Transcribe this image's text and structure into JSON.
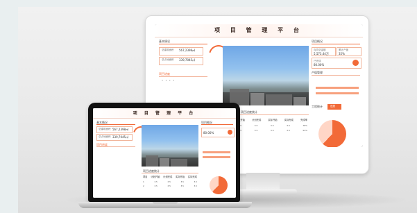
{
  "scene": {
    "background_color": "#e9eff0",
    "accent_color": "#f26a38"
  },
  "monitor": {
    "dashboard": {
      "title": "项 目 管 理 平 台",
      "left": {
        "panel_title": "基本情况",
        "metrics": [
          {
            "label": "总建筑面积",
            "value": "567,2398㎡"
          },
          {
            "label": "总占地面积",
            "value": "339,7045㎡"
          }
        ],
        "section_title": "项目进度"
      },
      "right": {
        "panel_title": "项目概况",
        "cards": [
          {
            "label": "合同总金额",
            "value": "5,573.44万"
          },
          {
            "label": "累计产值",
            "value": "35%"
          },
          {
            "label": "已完成",
            "value": "80.00%"
          }
        ],
        "section_title": "产值管理",
        "lower_title": "工程统计",
        "tab_active": "进度"
      },
      "table": {
        "title": "项目进度统计",
        "headers": [
          "项目",
          "计划开始",
          "计划完成",
          "实际开始",
          "实际完成",
          "完成率"
        ],
        "rows": [
          [
            "1",
            "3.5",
            "3.5",
            "3.5",
            "3.5",
            "78%"
          ],
          [
            "2",
            "3.5",
            "3.5",
            "3.5",
            "3.5",
            "54%"
          ]
        ]
      }
    }
  },
  "laptop": {
    "dashboard": {
      "title": "项 目 管 理 平 台",
      "left": {
        "panel_title": "基本情况",
        "metrics": [
          {
            "label": "总建筑面积",
            "value": "567,2398㎡"
          },
          {
            "label": "总占地面积",
            "value": "339,7045㎡"
          }
        ],
        "section_title": "项目进度"
      },
      "table": {
        "title": "项目进度统计",
        "headers": [
          "项目",
          "计划开始",
          "计划完成",
          "实际开始",
          "实际完成"
        ],
        "rows": [
          [
            "1",
            "3.5",
            "3.5",
            "3.5",
            "3.5"
          ],
          [
            "2",
            "3.5",
            "3.5",
            "3.5",
            "3.5"
          ]
        ]
      },
      "right": {
        "panel_title": "项目概况",
        "value": "80.00%"
      }
    }
  }
}
